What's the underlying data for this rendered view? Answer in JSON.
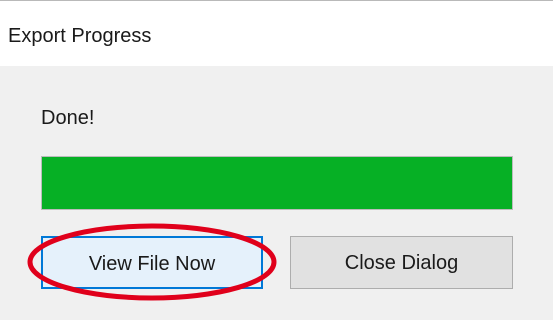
{
  "window": {
    "title": "Export Progress"
  },
  "status": {
    "text": "Done!"
  },
  "progress": {
    "percent": 100,
    "fill_color": "#06b025"
  },
  "buttons": {
    "view_file_label": "View File Now",
    "close_dialog_label": "Close Dialog"
  },
  "annotation": {
    "shape": "ellipse",
    "color": "#e0001b",
    "target": "view-file-now-button"
  }
}
